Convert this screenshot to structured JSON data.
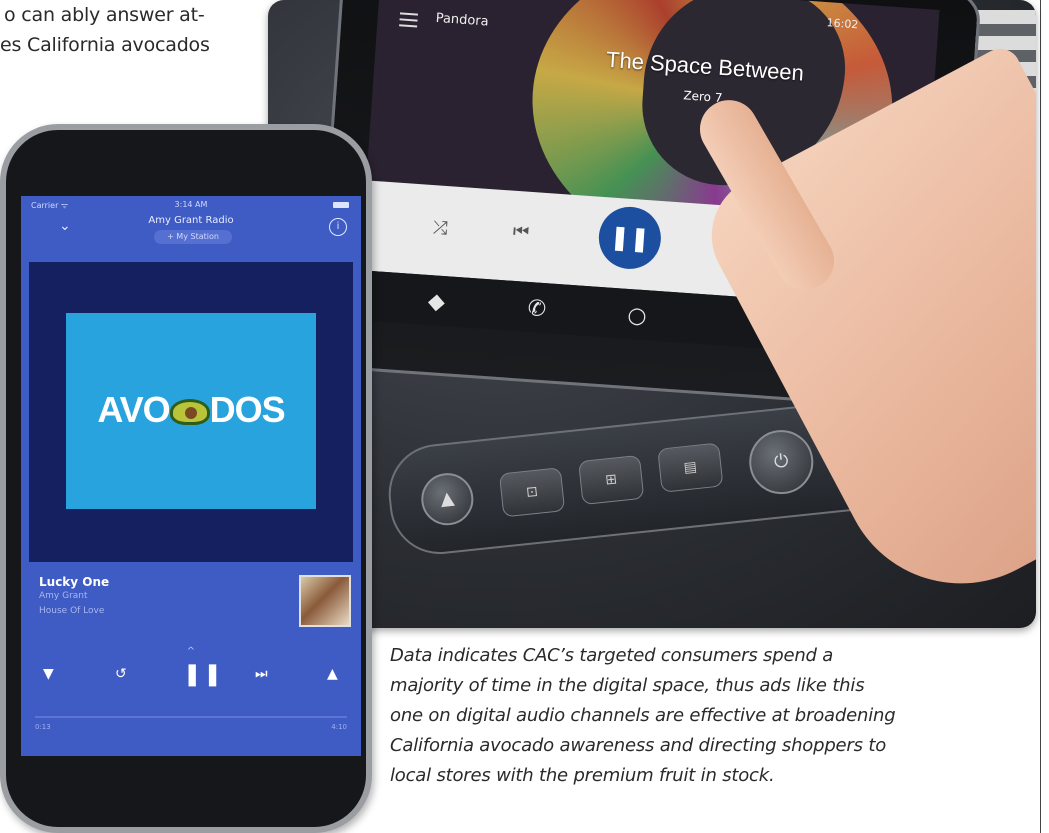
{
  "intro": {
    "lines": [
      "o can ably answer at-",
      "es California avocados"
    ]
  },
  "car_screen": {
    "app_name": "Pandora",
    "status_time": "16:02",
    "song_title": "The Space Between",
    "artist": "Zero 7",
    "icons": [
      "menu-icon",
      "shuffle-icon",
      "previous-icon",
      "pause-icon",
      "more-icon",
      "navigation-icon",
      "phone-icon",
      "home-icon",
      "recents-icon"
    ]
  },
  "phone": {
    "status": {
      "carrier": "Carrier ᯤ",
      "time": "3:14 AM"
    },
    "station_title": "Amy Grant Radio",
    "station_pill": "+ My Station",
    "album_art_text": {
      "before": "AVO",
      "after": "DOS"
    },
    "song": "Lucky One",
    "artist": "Amy Grant",
    "album": "House Of Love",
    "time_elapsed": "0:13",
    "time_total": "4:10",
    "colors": {
      "background": "#3f5bc4",
      "art_background": "#152060",
      "ad_card": "#29a3dd"
    }
  },
  "caption": {
    "lines": [
      "Data indicates CAC’s targeted consumers spend a",
      "majority of time in the digital space, thus ads like this",
      "one on digital audio channels are effective at broadening",
      "California avocado awareness and directing shoppers to",
      "local stores with the premium fruit in stock."
    ]
  }
}
